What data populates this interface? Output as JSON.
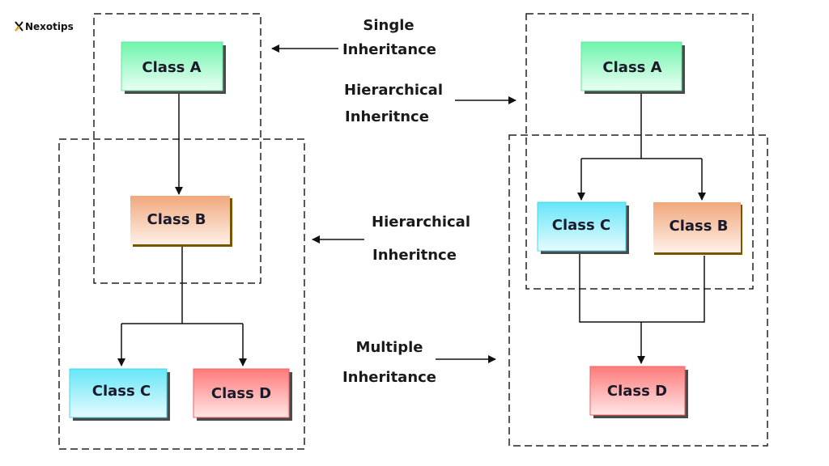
{
  "logo": {
    "text": "Nexotips",
    "accent": "#f5a623"
  },
  "labels": {
    "single": [
      "Single",
      "Inheritance"
    ],
    "hier_top": [
      "Hierarchical",
      "Inheritnce"
    ],
    "hier_mid": [
      "Hierarchical",
      "Inheritnce"
    ],
    "multiple": [
      "Multiple",
      "Inheritance"
    ]
  },
  "left": {
    "class_a": "Class A",
    "class_b": "Class B",
    "class_c": "Class C",
    "class_d": "Class D"
  },
  "right": {
    "class_a": "Class A",
    "class_c": "Class C",
    "class_b": "Class B",
    "class_d": "Class D"
  },
  "colors": {
    "class_a": "#6ff5ac",
    "class_b": "#f0a87c",
    "class_c": "#66e6f7",
    "class_d": "#ff7a7a"
  }
}
